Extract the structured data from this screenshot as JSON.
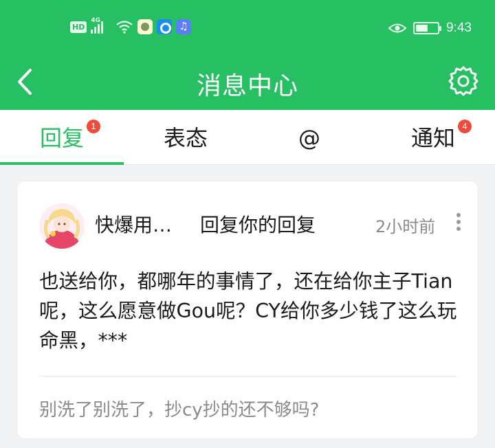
{
  "status_bar": {
    "hd": "HD",
    "network": "4G",
    "time": "9:43",
    "battery_level": 0.55,
    "icons": [
      "hd-icon",
      "signal-icon",
      "wifi-icon",
      "app-icon-1",
      "app-icon-2",
      "app-icon-3",
      "eye-icon",
      "battery-icon"
    ]
  },
  "header": {
    "title": "消息中心",
    "back_icon": "chevron-left-icon",
    "settings_icon": "gear-icon"
  },
  "tabs": [
    {
      "label": "回复",
      "badge": "1",
      "active": true
    },
    {
      "label": "表态",
      "badge": "",
      "active": false
    },
    {
      "label": "@",
      "badge": "",
      "active": false
    },
    {
      "label": "通知",
      "badge": "4",
      "active": false
    }
  ],
  "message": {
    "username": "快爆用…",
    "action": "回复你的回复",
    "time_ago": "2小时前",
    "content": "也送给你，都哪年的事情了，还在给你主子Tian呢，这么愿意做Gou呢？CY给你多少钱了这么玩命黑，***",
    "quoted": "别洗了别洗了，抄cy抄的还不够吗?"
  },
  "colors": {
    "brand_green": "#26c063",
    "badge_red": "#f04a3a",
    "secondary_text": "#8a8a8a"
  }
}
